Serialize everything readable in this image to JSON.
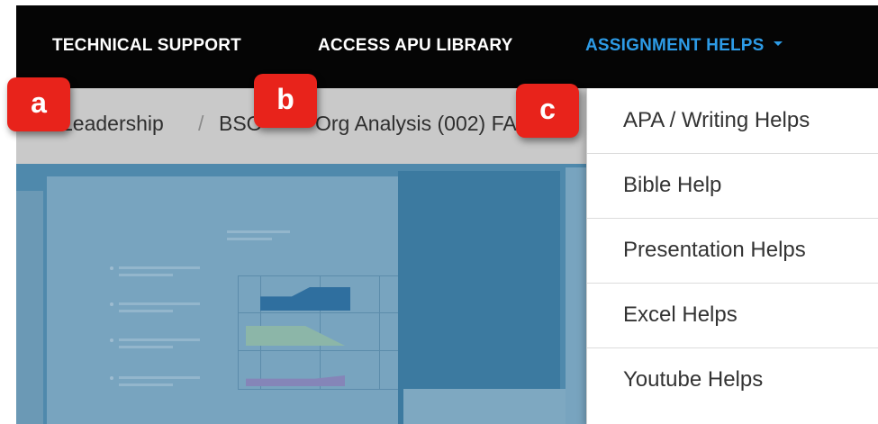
{
  "topnav": {
    "items": [
      {
        "label": "TECHNICAL SUPPORT"
      },
      {
        "label": "ACCESS APU LIBRARY"
      },
      {
        "label": "ASSIGNMENT HELPS"
      }
    ],
    "active_color": "#2d9be6"
  },
  "breadcrumb": {
    "items": [
      {
        "label": "Leadership"
      },
      {
        "label": "BSO"
      },
      {
        "label": "Org Analysis (002) FA"
      }
    ],
    "separator": "/"
  },
  "dropdown": {
    "items": [
      {
        "label": "APA / Writing Helps"
      },
      {
        "label": "Bible Help"
      },
      {
        "label": "Presentation Helps"
      },
      {
        "label": "Excel Helps"
      },
      {
        "label": "Youtube Helps"
      }
    ]
  },
  "annotations": {
    "badges": [
      {
        "label": "a"
      },
      {
        "label": "b"
      },
      {
        "label": "c"
      }
    ],
    "color": "#e8231b"
  },
  "icons": {
    "dropdown_caret": "chevron-down-icon"
  }
}
